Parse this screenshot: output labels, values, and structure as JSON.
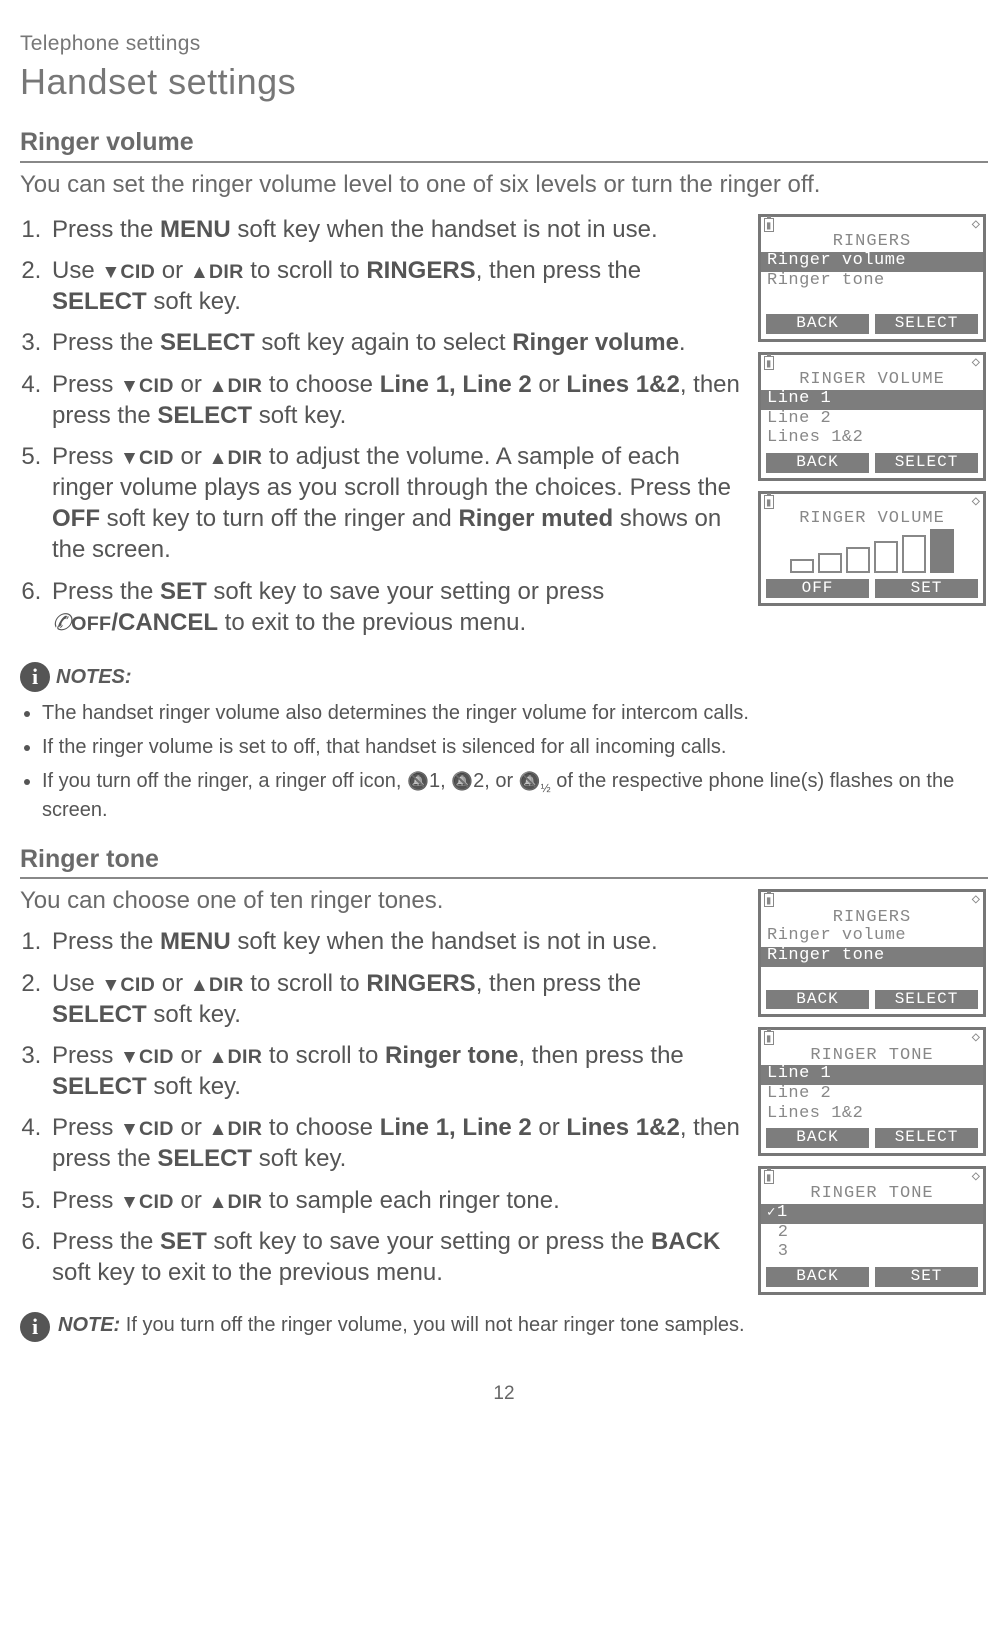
{
  "header": {
    "small": "Telephone settings",
    "large": "Handset settings"
  },
  "section1": {
    "heading": "Ringer volume",
    "intro": "You can set the ringer volume level to one of six levels or turn the ringer off.",
    "steps": {
      "s1_a": "Press the ",
      "s1_b": "MENU",
      "s1_c": " soft key when the handset is not in use.",
      "s2_a": "Use ",
      "s2_cid": "CID",
      "s2_or": " or ",
      "s2_dir": "DIR",
      "s2_b": " to scroll to ",
      "s2_ringers": "RINGERS",
      "s2_c": ", then press the ",
      "s2_select": "SELECT",
      "s2_d": " soft key.",
      "s3_a": "Press the ",
      "s3_select": "SELECT",
      "s3_b": " soft key again to select ",
      "s3_rv": "Ringer volume",
      "s3_c": ".",
      "s4_a": "Press ",
      "s4_cid": "CID",
      "s4_or": " or ",
      "s4_dir": "DIR",
      "s4_b": " to choose ",
      "s4_lines": "Line 1, Line 2",
      "s4_or2": " or ",
      "s4_lines2": "Lines 1&2",
      "s4_c": ", then press the ",
      "s4_select": "SELECT",
      "s4_d": " soft key.",
      "s5_a": "Press ",
      "s5_cid": "CID",
      "s5_or": " or ",
      "s5_dir": "DIR",
      "s5_b": " to adjust the volume. A sample of each ringer volume plays as you scroll through the choices. Press the ",
      "s5_off": "OFF",
      "s5_c": " soft key to turn off the ringer and ",
      "s5_rm": "Ringer muted",
      "s5_d": " shows on the screen.",
      "s6_a": "Press the ",
      "s6_set": "SET",
      "s6_b": " soft key to save your setting or press ",
      "s6_off": "OFF",
      "s6_c": "/",
      "s6_cancel": "CANCEL",
      "s6_d": " to exit to the previous menu."
    },
    "notes_label": "NOTES:",
    "notes": {
      "n1": "The handset ringer volume also determines the ringer volume for intercom calls.",
      "n2": "If the ringer volume is set to off, that handset is silenced for all incoming calls.",
      "n3_a": "If you turn off the ringer, a ringer off icon, ",
      "n3_1": "1, ",
      "n3_2": "2, or ",
      "n3_12": "½",
      "n3_b": " of the respective phone line(s) flashes on the screen."
    },
    "lcd1": {
      "title": "RINGERS",
      "line1": "Ringer volume",
      "line2": "Ringer tone",
      "back": "BACK",
      "select": "SELECT"
    },
    "lcd2": {
      "title": "RINGER VOLUME",
      "line1": "Line 1",
      "line2": "Line 2",
      "line3": "Lines 1&2",
      "back": "BACK",
      "select": "SELECT"
    },
    "lcd3": {
      "title": "RINGER VOLUME",
      "off": "OFF",
      "set": "SET"
    }
  },
  "section2": {
    "heading": "Ringer tone",
    "intro": "You can choose one of ten ringer tones.",
    "steps": {
      "s1_a": "Press the ",
      "s1_b": "MENU",
      "s1_c": " soft key when the handset is not in use.",
      "s2_a": "Use ",
      "s2_cid": "CID",
      "s2_or": " or ",
      "s2_dir": "DIR",
      "s2_b": " to scroll to ",
      "s2_ringers": "RINGERS",
      "s2_c": ", then press the ",
      "s2_select": "SELECT",
      "s2_d": " soft key.",
      "s3_a": "Press ",
      "s3_cid": "CID",
      "s3_or": " or ",
      "s3_dir": "DIR",
      "s3_b": " to scroll to ",
      "s3_rt": "Ringer tone",
      "s3_c": ", then press the ",
      "s3_select": "SELECT",
      "s3_d": " soft key.",
      "s4_a": "Press ",
      "s4_cid": "CID",
      "s4_or": " or ",
      "s4_dir": "DIR",
      "s4_b": " to choose ",
      "s4_lines": "Line 1, Line 2",
      "s4_or2": " or ",
      "s4_lines2": "Lines 1&2",
      "s4_c": ", then press the ",
      "s4_select": "SELECT",
      "s4_d": " soft key.",
      "s5_a": "Press ",
      "s5_cid": "CID",
      "s5_or": " or ",
      "s5_dir": "DIR",
      "s5_b": " to sample each ringer tone.",
      "s6_a": "Press the ",
      "s6_set": "SET",
      "s6_b": " soft key to save your setting or press the ",
      "s6_back": "BACK",
      "s6_c": " soft key to exit to the previous menu."
    },
    "note_label": "NOTE:",
    "note_text": " If you turn off the ringer volume, you will not hear ringer tone samples.",
    "lcd1": {
      "title": "RINGERS",
      "line1": "Ringer volume",
      "line2": "Ringer tone",
      "back": "BACK",
      "select": "SELECT"
    },
    "lcd2": {
      "title": "RINGER TONE",
      "line1": "Line 1",
      "line2": "Line 2",
      "line3": "Lines 1&2",
      "back": "BACK",
      "select": "SELECT"
    },
    "lcd3": {
      "title": "RINGER TONE",
      "o1": "1",
      "o2": "2",
      "o3": "3",
      "back": "BACK",
      "set": "SET"
    }
  },
  "page_number": "12"
}
